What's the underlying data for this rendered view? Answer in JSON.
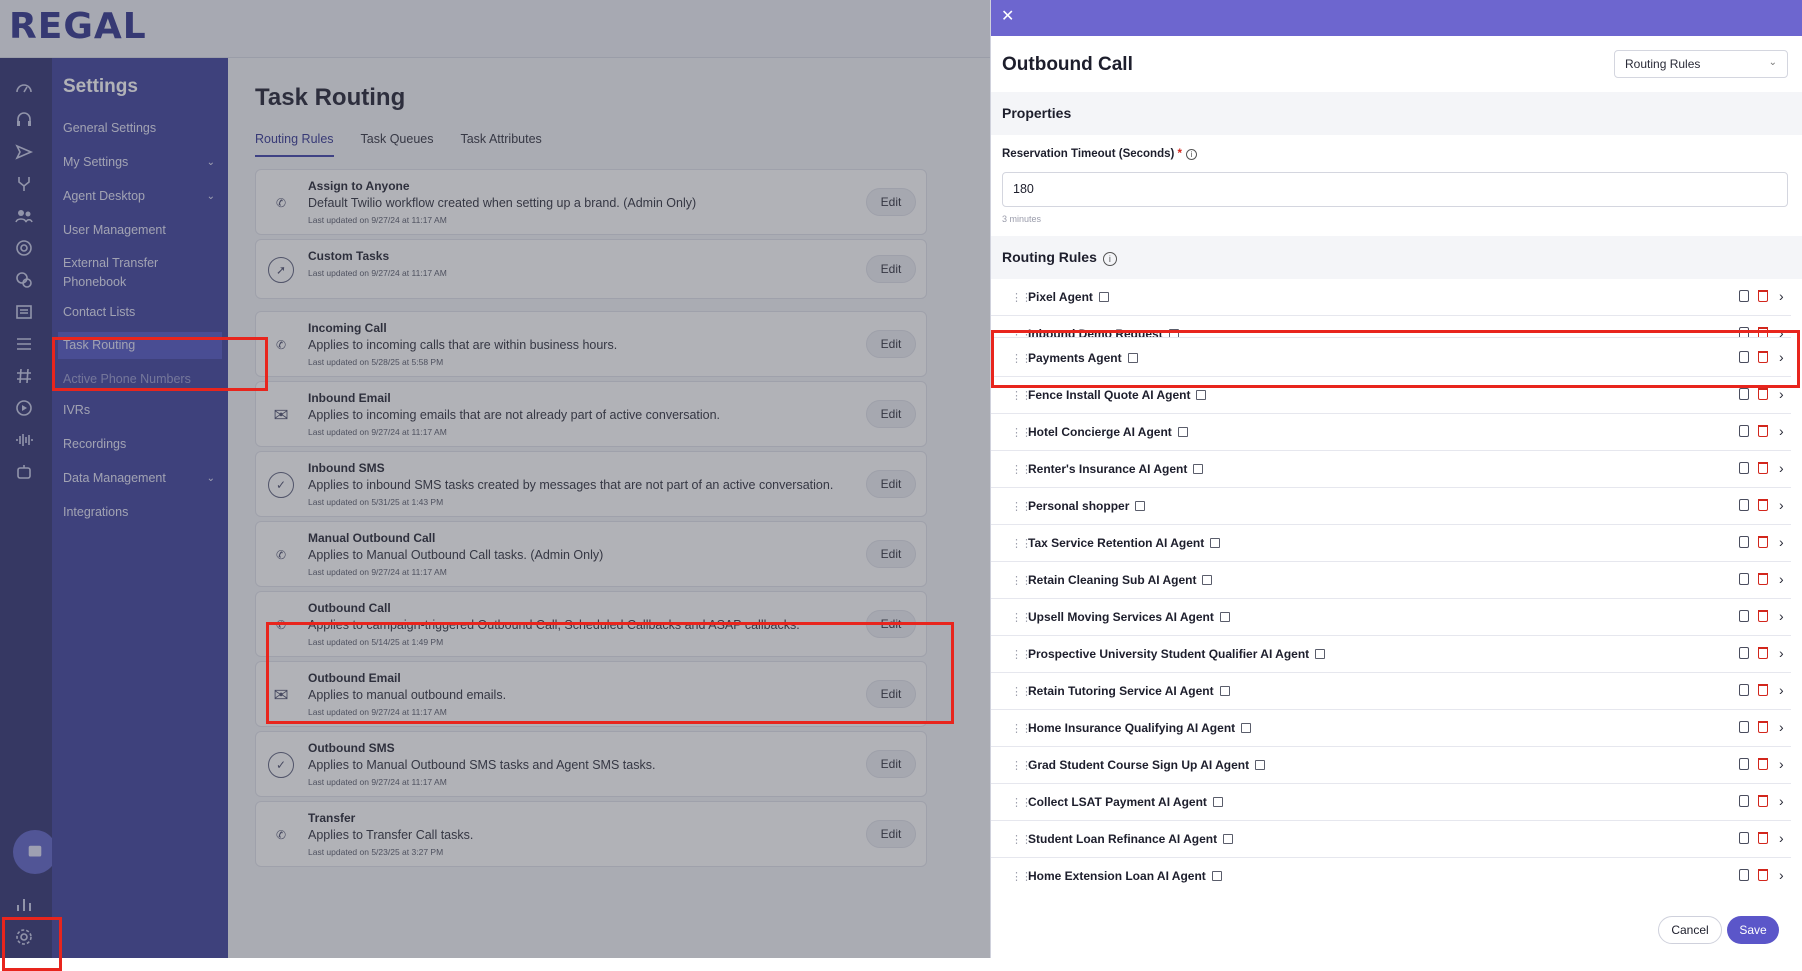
{
  "app": {
    "logo": "REGAL"
  },
  "settings_menu": {
    "title": "Settings",
    "items": [
      {
        "label": "General Settings",
        "chevron": false
      },
      {
        "label": "My Settings",
        "chevron": true
      },
      {
        "label": "Agent Desktop",
        "chevron": true
      },
      {
        "label": "User Management",
        "chevron": false
      },
      {
        "label": "External Transfer Phonebook",
        "chevron": false
      },
      {
        "label": "Contact Lists",
        "chevron": false
      },
      {
        "label": "Task Routing",
        "chevron": false,
        "active": true
      },
      {
        "label": "Active Phone Numbers",
        "chevron": false
      },
      {
        "label": "IVRs",
        "chevron": false
      },
      {
        "label": "Recordings",
        "chevron": false
      },
      {
        "label": "Data Management",
        "chevron": true
      },
      {
        "label": "Integrations",
        "chevron": false
      }
    ]
  },
  "main": {
    "title": "Task Routing",
    "tabs": [
      "Routing Rules",
      "Task Queues",
      "Task Attributes"
    ],
    "edit_label": "Edit",
    "workflows": [
      {
        "title": "Assign to Anyone",
        "description": "Default Twilio workflow created when setting up a brand. (Admin Only)",
        "updated": "Last updated on 9/27/24 at 11:17 AM",
        "icon": "phone-forward-icon"
      },
      {
        "title": "Custom Tasks",
        "description": "",
        "updated": "Last updated on 9/27/24 at 11:17 AM",
        "icon": "compass-icon"
      },
      {
        "title": "Incoming Call",
        "description": "Applies to incoming calls that are within business hours.",
        "updated": "Last updated on 5/28/25 at 5:58 PM",
        "icon": "phone-icon"
      },
      {
        "title": "Inbound Email",
        "description": "Applies to incoming emails that are not already part of active conversation.",
        "updated": "Last updated on 9/27/24 at 11:17 AM",
        "icon": "mail-icon"
      },
      {
        "title": "Inbound SMS",
        "description": "Applies to inbound SMS tasks created by messages that are not part of an active conversation.",
        "updated": "Last updated on 5/31/25 at 1:43 PM",
        "icon": "sms-icon"
      },
      {
        "title": "Manual Outbound Call",
        "description": "Applies to Manual Outbound Call tasks. (Admin Only)",
        "updated": "Last updated on 9/27/24 at 11:17 AM",
        "icon": "phone-icon"
      },
      {
        "title": "Outbound Call",
        "description": "Applies to campaign-triggered Outbound Call, Scheduled Callbacks and ASAP callbacks.",
        "updated": "Last updated on 5/14/25 at 1:49 PM",
        "icon": "phone-icon"
      },
      {
        "title": "Outbound Email",
        "description": "Applies to manual outbound emails.",
        "updated": "Last updated on 9/27/24 at 11:17 AM",
        "icon": "mail-icon"
      },
      {
        "title": "Outbound SMS",
        "description": "Applies to Manual Outbound SMS tasks and Agent SMS tasks.",
        "updated": "Last updated on 9/27/24 at 11:17 AM",
        "icon": "sms-icon"
      },
      {
        "title": "Transfer",
        "description": "Applies to Transfer Call tasks.",
        "updated": "Last updated on 5/23/25 at 3:27 PM",
        "icon": "phone-icon"
      }
    ]
  },
  "panel": {
    "title": "Outbound Call",
    "view_select": "Routing Rules",
    "properties_title": "Properties",
    "timeout_label": "Reservation Timeout (Seconds)",
    "timeout_required": "*",
    "timeout_value": "180",
    "timeout_hint": "3 minutes",
    "rules_title": "Routing Rules",
    "rules": [
      "Pixel Agent",
      "Inbound Demo Request",
      "Payments Agent",
      "Fence Install Quote AI Agent",
      "Hotel Concierge AI Agent",
      "Renter's Insurance AI Agent",
      "Personal shopper",
      "Tax Service Retention AI Agent",
      "Retain Cleaning Sub AI Agent",
      "Upsell Moving Services AI Agent",
      "Prospective University Student Qualifier AI Agent",
      "Retain Tutoring Service AI Agent",
      "Home Insurance Qualifying AI Agent",
      "Grad Student Course Sign Up AI Agent",
      "Collect LSAT Payment AI Agent",
      "Student Loan Refinance AI Agent",
      "Home Extension Loan AI Agent"
    ],
    "cancel_label": "Cancel",
    "save_label": "Save"
  },
  "colors": {
    "brand": "#2c2f8a",
    "accent": "#6d66cf",
    "highlight": "#e8251d",
    "delete": "#d2261c"
  }
}
